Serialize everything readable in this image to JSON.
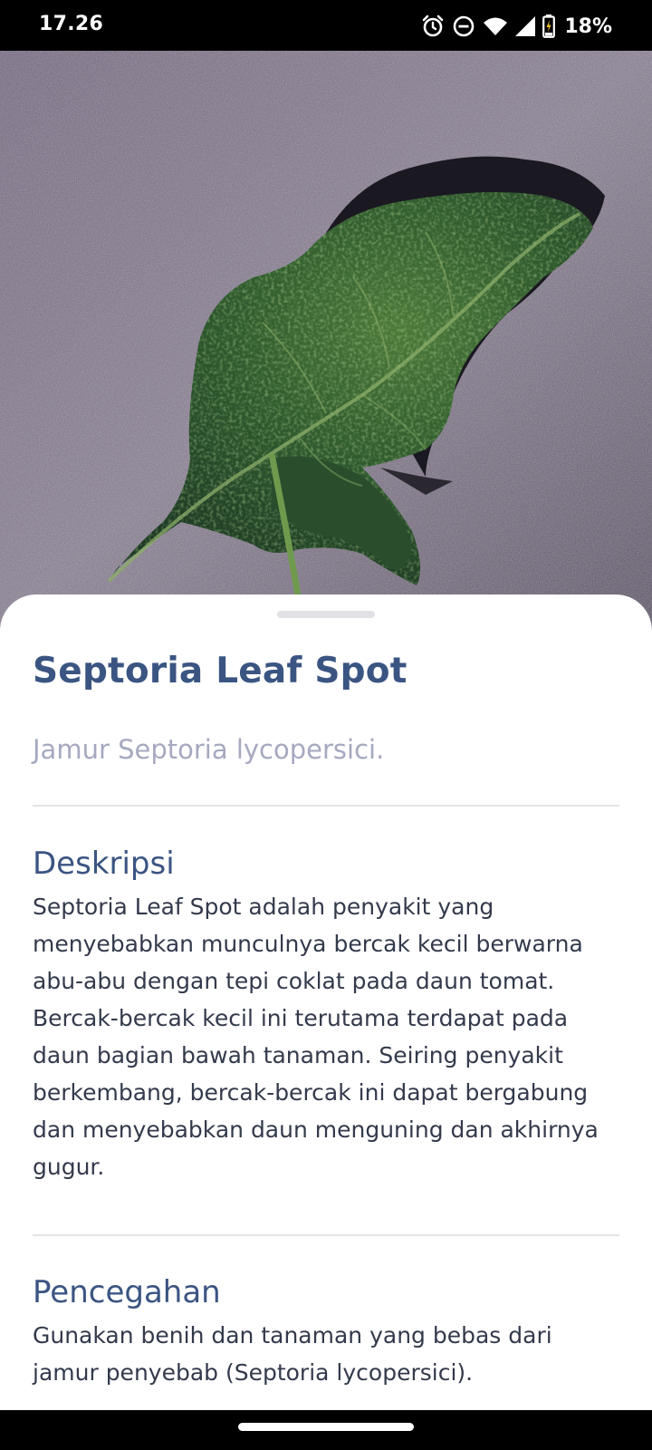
{
  "status_bar": {
    "time": "17.26",
    "battery": "18%",
    "icons": [
      "alarm-icon",
      "do-not-disturb-icon",
      "wifi-icon",
      "signal-icon",
      "battery-charging-icon"
    ]
  },
  "hero": {
    "image": "tomato-leaf-photo"
  },
  "disease": {
    "title": "Septoria Leaf Spot",
    "cause": "Jamur Septoria lycopersici."
  },
  "sections": [
    {
      "heading": "Deskripsi",
      "text": "Septoria Leaf Spot adalah penyakit yang menyebabkan munculnya bercak kecil berwarna abu-abu dengan tepi coklat pada daun tomat. Bercak-bercak kecil ini terutama terdapat pada daun bagian bawah tanaman. Seiring penyakit berkembang, bercak-bercak ini dapat bergabung dan menyebabkan daun menguning dan akhirnya gugur."
    },
    {
      "heading": "Pencegahan",
      "text": "Gunakan benih dan tanaman yang bebas dari jamur penyebab (Septoria lycopersici)."
    }
  ],
  "colors": {
    "title": "#3b5582",
    "subtitle": "#a6a9c0",
    "body": "#343a4c",
    "divider": "#e3e4e8"
  }
}
